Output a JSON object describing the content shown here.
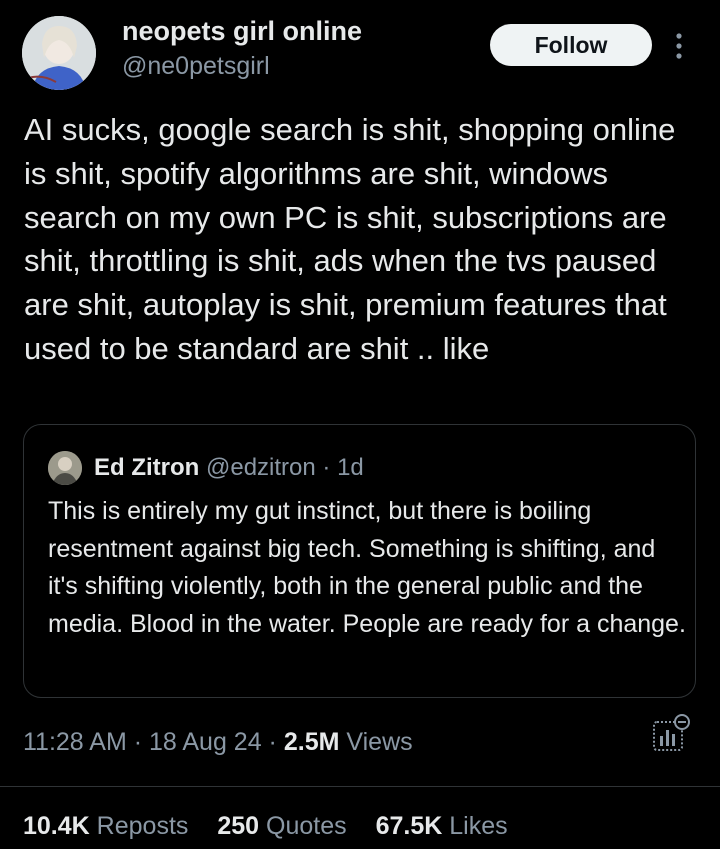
{
  "author": {
    "name": "neopets girl online",
    "handle": "@ne0petsgirl"
  },
  "follow_label": "Follow",
  "post_text": "AI sucks, google search is shit, shopping online is shit, spotify algorithms are shit, windows search on my own PC is shit, subscriptions are shit, throttling is shit, ads when the tvs paused are shit, autoplay is shit, premium features that used to be standard are shit .. like",
  "quote": {
    "name": "Ed Zitron",
    "handle": "@edzitron",
    "age": "· 1d",
    "text": "This is entirely my gut instinct, but there is boiling resentment against big tech. Something is shifting, and it's shifting violently, both in the general public and the media. Blood in the water. People are ready for a change."
  },
  "meta": {
    "time": "11:28 AM",
    "date": "· 18 Aug 24 ·",
    "views_count": "2.5M",
    "views_label": "Views"
  },
  "stats": {
    "reposts_count": "10.4K",
    "reposts_label": "Reposts",
    "quotes_count": "250",
    "quotes_label": "Quotes",
    "likes_count": "67.5K",
    "likes_label": "Likes"
  },
  "colors": {
    "background": "#000000",
    "text": "#e7e9ea",
    "secondary": "#8b98a5",
    "border": "#2f3336",
    "button_bg": "#eff3f4"
  },
  "icons": {
    "more": "more-vertical-icon",
    "analytics": "analytics-icon"
  }
}
